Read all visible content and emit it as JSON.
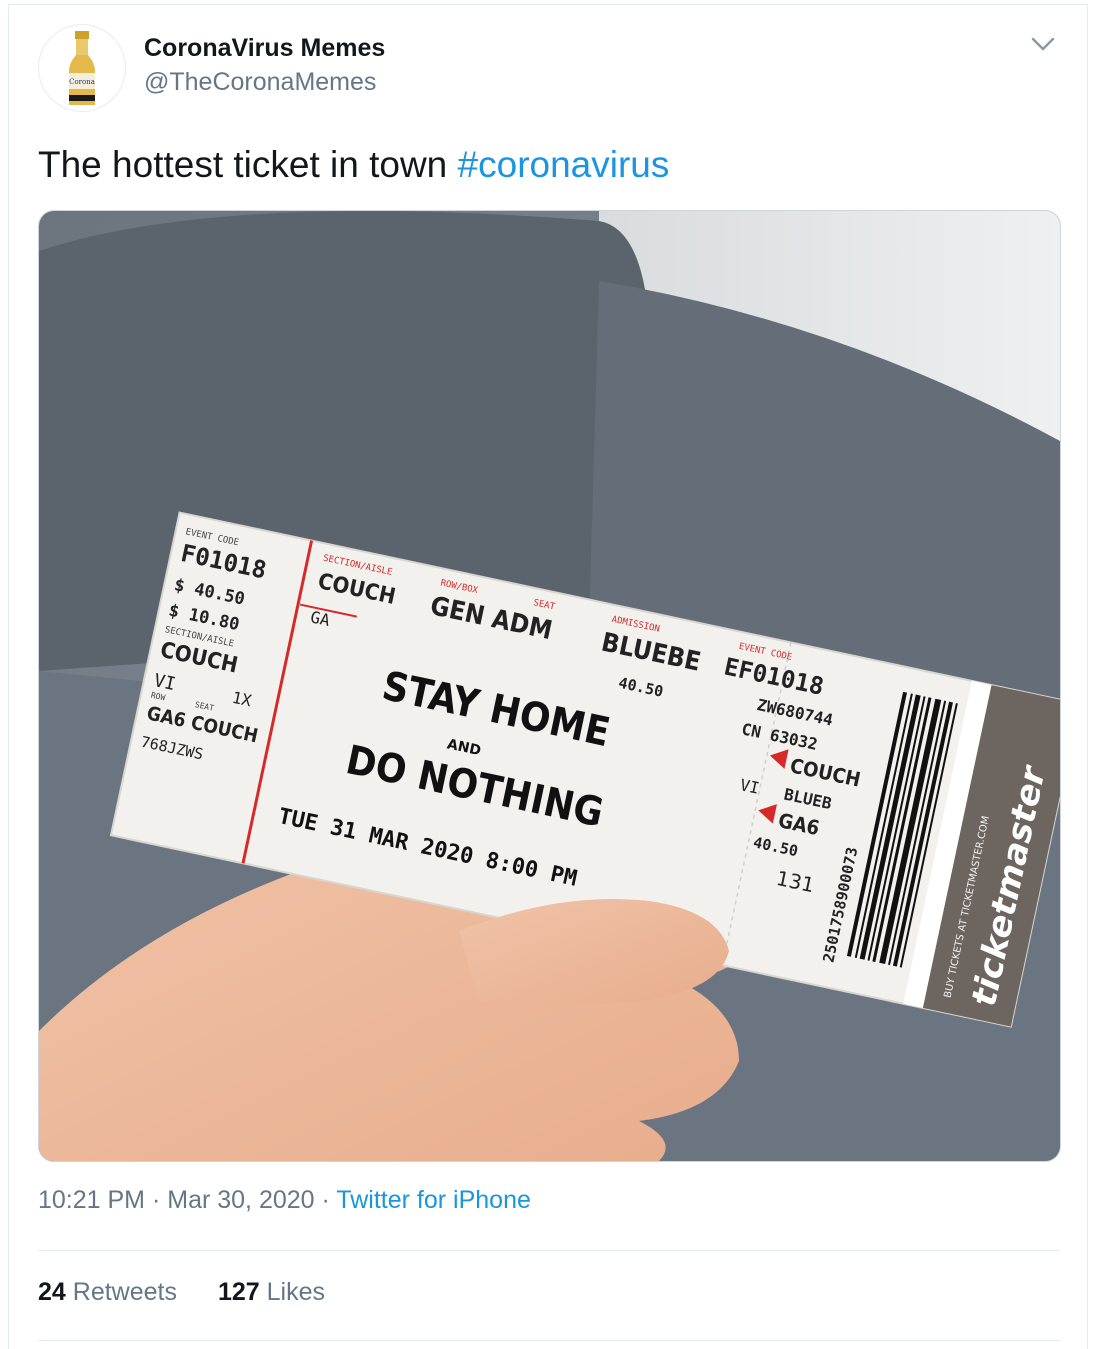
{
  "user": {
    "display_name": "CoronaVirus Memes",
    "handle": "@TheCoronaMemes",
    "avatar_icon": "beer-bottle-icon",
    "avatar_label": "Corona"
  },
  "tweet": {
    "text": "The hottest ticket in town ",
    "hashtag": "#coronavirus"
  },
  "ticket": {
    "event_code_label": "EVENT CODE",
    "event_code": "F01018",
    "price1": "$ 40.50",
    "price2": "$ 10.80",
    "section_aisle_label": "SECTION/AISLE",
    "stub_section": "COUCH",
    "stub_vi": "VI",
    "stub_row_label": "ROW",
    "stub_seat_label": "SEAT",
    "stub_count": "1X",
    "stub_row_seat": "GA6 COUCH",
    "stub_code": "768JZWS",
    "main_section_label": "SECTION/AISLE",
    "main_section": "COUCH",
    "main_ga": "GA",
    "row_box_label": "ROW/BOX",
    "seat_label": "SEAT",
    "row_box": "GEN ADM",
    "admission_label": "ADMISSION",
    "admission": "BLUEBE",
    "admission_price": "40.50",
    "headline1": "STAY HOME",
    "headline_and": "AND",
    "headline2": "DO NOTHING",
    "date": "TUE 31 MAR 2020 8:00 PM",
    "right_event_code_label": "EVENT CODE",
    "right_event_code": "EF01018",
    "right_code1": "ZW680744",
    "right_code2": "CN 63032",
    "right_section": "COUCH",
    "right_vi": "VI",
    "right_adm": "BLUEB",
    "right_row": "GA6",
    "right_price": "40.50",
    "right_seat": "131",
    "barcode_number": "2501758900073",
    "brand": "ticketmaster",
    "brand_small": "BUY TICKETS AT TICKETMASTER.COM"
  },
  "meta": {
    "time": "10:21 PM",
    "date": "Mar 30, 2020",
    "separator": "·",
    "source": "Twitter for iPhone"
  },
  "stats": {
    "retweets_count": "24",
    "retweets_label": "Retweets",
    "likes_count": "127",
    "likes_label": "Likes"
  },
  "colors": {
    "link": "#1b95e0",
    "secondary": "#657786",
    "border": "#e6ecf0",
    "ticket_red": "#d62a2a"
  }
}
